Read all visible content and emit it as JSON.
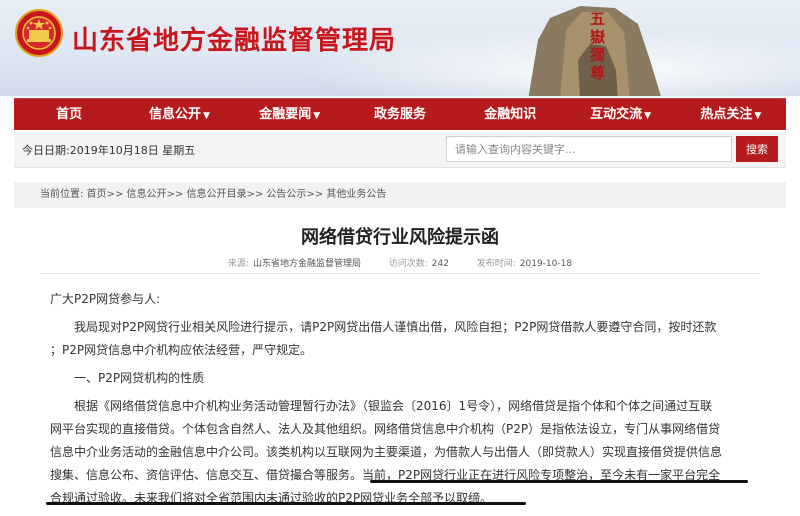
{
  "site": {
    "title": "山东省地方金融监督管理局",
    "mountain_text": "五嶽獨尊"
  },
  "nav": [
    {
      "label": "首页",
      "dropdown": false
    },
    {
      "label": "信息公开",
      "dropdown": true
    },
    {
      "label": "金融要闻",
      "dropdown": true
    },
    {
      "label": "政务服务",
      "dropdown": false
    },
    {
      "label": "金融知识",
      "dropdown": false
    },
    {
      "label": "互动交流",
      "dropdown": true
    },
    {
      "label": "热点关注",
      "dropdown": true
    }
  ],
  "datebar": {
    "date_text": "今日日期:2019年10月18日  星期五"
  },
  "search": {
    "placeholder": "请输入查询内容关键字...",
    "button_label": "搜索"
  },
  "breadcrumb": {
    "prefix": "当前位置:",
    "items": [
      "首页",
      "信息公开",
      "信息公开目录",
      "公告公示",
      "其他业务公告"
    ]
  },
  "article": {
    "title": "网络借贷行业风险提示函",
    "source_label": "来源:",
    "source": "山东省地方金融监督管理局",
    "views_label": "访问次数:",
    "views": "242",
    "date_label": "发布时间:",
    "date": "2019-10-18",
    "lines": [
      "广大P2P网贷参与人:",
      "　　我局现对P2P网贷行业相关风险进行提示，请P2P网贷出借人谨慎出借，风险自担；P2P网贷借款人要遵守合同，按时还款",
      "；P2P网贷信息中介机构应依法经营，严守规定。",
      "　　一、P2P网贷机构的性质",
      "　　根据《网络借贷信息中介机构业务活动管理暂行办法》（银监会〔2016〕1号令），网络借贷是指个体和个体之间通过互联",
      "网平台实现的直接借贷。个体包含自然人、法人及其他组织。网络借贷信息中介机构（P2P）是指依法设立，专门从事网络借贷",
      "信息中介业务活动的金融信息中介公司。该类机构以互联网为主要渠道，为借款人与出借人（即贷款人）实现直接借贷提供信息",
      "搜集、信息公布、资信评估、信息交互、借贷撮合等服务。当前，P2P网贷行业正在进行风险专项整治，至今未有一家平台完全",
      "合规通过验收。未来我们将对全省范围内未通过验收的P2P网贷业务全部予以取缔。"
    ]
  },
  "colors": {
    "brand_red": "#b51a1d",
    "title_red": "#c8161d"
  }
}
